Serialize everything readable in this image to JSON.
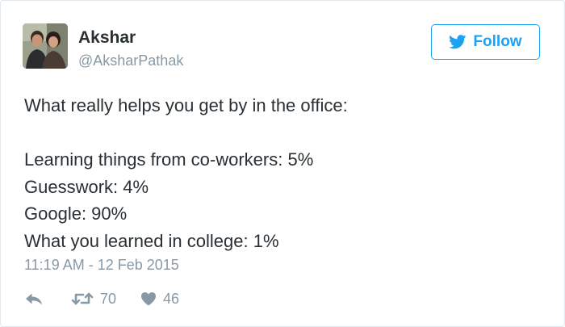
{
  "user": {
    "name": "Akshar",
    "handle": "@AksharPathak",
    "avatar_icon": "profile-photo"
  },
  "follow_button": {
    "label": "Follow",
    "icon": "twitter-bird-icon",
    "color": "#1da1f2"
  },
  "tweet": {
    "lines": [
      "What really helps you get by in the office:",
      "",
      "Learning things from co-workers: 5%",
      "Guesswork: 4%",
      "Google: 90%",
      "What you learned in college: 1%"
    ],
    "timestamp": "11:19 AM - 12 Feb 2015"
  },
  "actions": {
    "reply_icon": "reply-icon",
    "retweet_icon": "retweet-icon",
    "retweet_count": "70",
    "like_icon": "heart-icon",
    "like_count": "46"
  },
  "colors": {
    "text": "#292f33",
    "muted": "#8899a6",
    "accent": "#1da1f2",
    "border": "#e1e8ed"
  }
}
